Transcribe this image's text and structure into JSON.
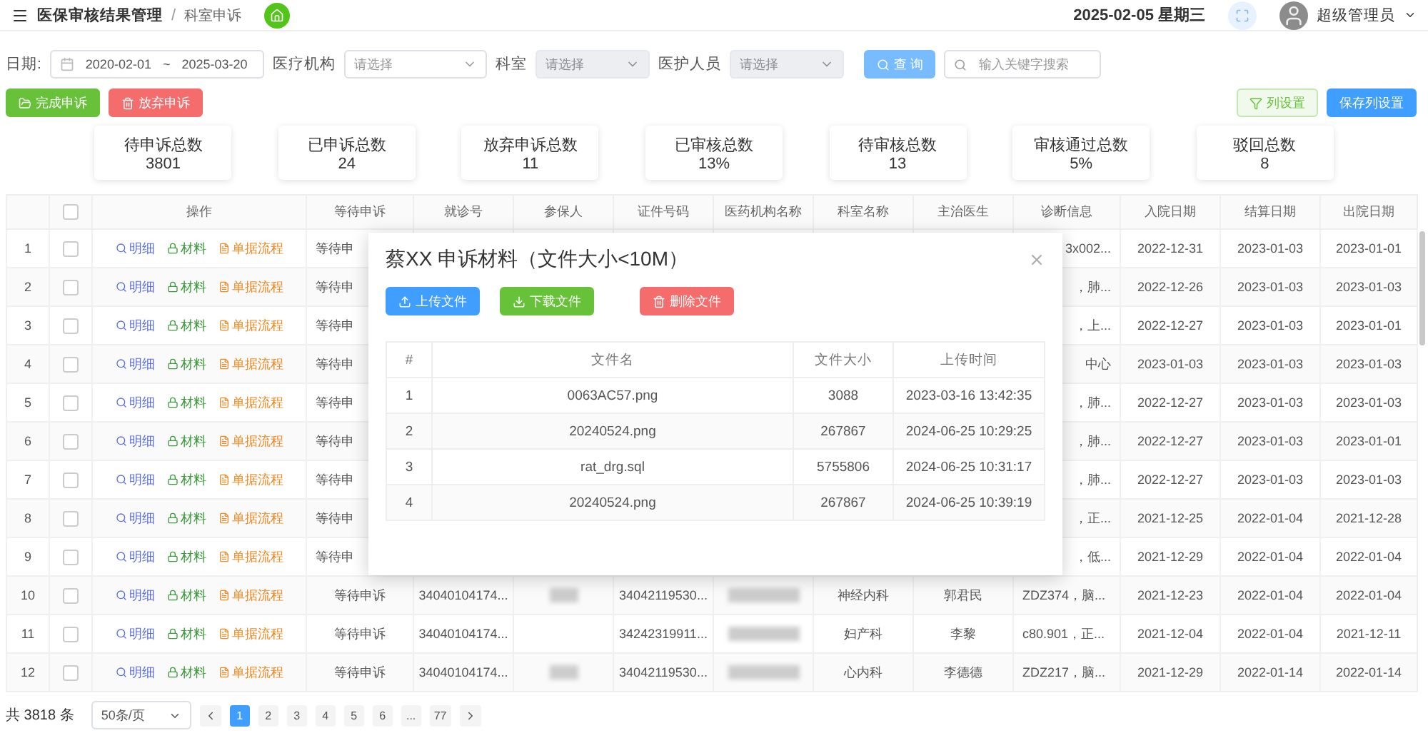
{
  "header": {
    "title": "医保审核结果管理",
    "separator": "/",
    "page": "科室申诉",
    "date": "2025-02-05 星期三",
    "user": "超级管理员"
  },
  "filters": [
    {
      "kind": "date",
      "label": "日期:",
      "start": "2020-02-01",
      "sep": "~",
      "end": "2025-03-20"
    },
    {
      "kind": "select",
      "label": "医疗机构",
      "placeholder": "请选择",
      "disabled": false
    },
    {
      "kind": "select",
      "label": "科室",
      "placeholder": "请选择",
      "disabled": true
    },
    {
      "kind": "select",
      "label": "医护人员",
      "placeholder": "请选择",
      "disabled": true
    },
    {
      "kind": "button",
      "label": "查 询"
    },
    {
      "kind": "search",
      "placeholder": "输入关键字搜索"
    }
  ],
  "actions": [
    {
      "label": "完成申诉",
      "kind": "complete"
    },
    {
      "label": "放弃申诉",
      "kind": "abandon"
    }
  ],
  "column_actions": [
    {
      "label": "列设置",
      "kind": "outline"
    },
    {
      "label": "保存列设置",
      "kind": "primary"
    }
  ],
  "stats": [
    {
      "label": "待申诉总数",
      "value": "3801"
    },
    {
      "label": "已申诉总数",
      "value": "24"
    },
    {
      "label": "放弃申诉总数",
      "value": "11"
    },
    {
      "label": "已审核总数",
      "value": "13%"
    },
    {
      "label": "待审核总数",
      "value": "13"
    },
    {
      "label": "审核通过总数",
      "value": "5%"
    },
    {
      "label": "驳回总数",
      "value": "8"
    }
  ],
  "table": {
    "columns": [
      "操作",
      "等待申诉",
      "就诊号",
      "参保人",
      "证件号码",
      "医药机构名称",
      "科室名称",
      "主治医生",
      "诊断信息",
      "入院日期",
      "结算日期",
      "出院日期"
    ],
    "select_all_checked": false,
    "rows": [
      {
        "kind": "partly_hidden",
        "index": "1",
        "checked": false,
        "actions": [
          {
            "label": "明细",
            "kind": "detail"
          },
          {
            "label": "材料",
            "kind": "material"
          },
          {
            "label": "单据流程",
            "kind": "flow"
          }
        ],
        "status": "等待申",
        "diagnosis": "3x002...",
        "admit": "2022-12-31",
        "settle": "2023-01-03",
        "discharge": "2023-01-01"
      },
      {
        "kind": "partly_hidden",
        "index": "2",
        "checked": false,
        "actions": [
          {
            "label": "明细",
            "kind": "detail"
          },
          {
            "label": "材料",
            "kind": "material"
          },
          {
            "label": "单据流程",
            "kind": "flow"
          }
        ],
        "status": "等待申",
        "diagnosis": "，肺...",
        "admit": "2022-12-26",
        "settle": "2023-01-03",
        "discharge": "2023-01-03"
      },
      {
        "kind": "partly_hidden",
        "index": "3",
        "checked": false,
        "actions": [
          {
            "label": "明细",
            "kind": "detail"
          },
          {
            "label": "材料",
            "kind": "material"
          },
          {
            "label": "单据流程",
            "kind": "flow"
          }
        ],
        "status": "等待申",
        "diagnosis": "，上...",
        "admit": "2022-12-27",
        "settle": "2023-01-03",
        "discharge": "2023-01-01"
      },
      {
        "kind": "partly_hidden",
        "index": "4",
        "checked": false,
        "actions": [
          {
            "label": "明细",
            "kind": "detail"
          },
          {
            "label": "材料",
            "kind": "material"
          },
          {
            "label": "单据流程",
            "kind": "flow"
          }
        ],
        "status": "等待申",
        "diagnosis": "中心",
        "admit": "2023-01-03",
        "settle": "2023-01-03",
        "discharge": "2023-01-03"
      },
      {
        "kind": "partly_hidden",
        "index": "5",
        "checked": false,
        "actions": [
          {
            "label": "明细",
            "kind": "detail"
          },
          {
            "label": "材料",
            "kind": "material"
          },
          {
            "label": "单据流程",
            "kind": "flow"
          }
        ],
        "status": "等待申",
        "diagnosis": "，肺...",
        "admit": "2022-12-27",
        "settle": "2023-01-03",
        "discharge": "2023-01-03"
      },
      {
        "kind": "partly_hidden",
        "index": "6",
        "checked": false,
        "actions": [
          {
            "label": "明细",
            "kind": "detail"
          },
          {
            "label": "材料",
            "kind": "material"
          },
          {
            "label": "单据流程",
            "kind": "flow"
          }
        ],
        "status": "等待申",
        "diagnosis": "，肺...",
        "admit": "2022-12-27",
        "settle": "2023-01-03",
        "discharge": "2023-01-01"
      },
      {
        "kind": "partly_hidden",
        "index": "7",
        "checked": false,
        "actions": [
          {
            "label": "明细",
            "kind": "detail"
          },
          {
            "label": "材料",
            "kind": "material"
          },
          {
            "label": "单据流程",
            "kind": "flow"
          }
        ],
        "status": "等待申",
        "diagnosis": "，肺...",
        "admit": "2022-12-27",
        "settle": "2023-01-03",
        "discharge": "2023-01-03"
      },
      {
        "kind": "partly_hidden",
        "index": "8",
        "checked": false,
        "actions": [
          {
            "label": "明细",
            "kind": "detail"
          },
          {
            "label": "材料",
            "kind": "material"
          },
          {
            "label": "单据流程",
            "kind": "flow"
          }
        ],
        "status": "等待申",
        "diagnosis": "，正...",
        "admit": "2021-12-25",
        "settle": "2022-01-04",
        "discharge": "2021-12-28"
      },
      {
        "kind": "partly_hidden",
        "index": "9",
        "checked": false,
        "actions": [
          {
            "label": "明细",
            "kind": "detail"
          },
          {
            "label": "材料",
            "kind": "material"
          },
          {
            "label": "单据流程",
            "kind": "flow"
          }
        ],
        "status": "等待申",
        "diagnosis": "，低...",
        "admit": "2021-12-29",
        "settle": "2022-01-04",
        "discharge": "2022-01-04"
      },
      {
        "kind": "full",
        "index": "10",
        "checked": false,
        "actions": [
          {
            "label": "明细",
            "kind": "detail"
          },
          {
            "label": "材料",
            "kind": "material"
          },
          {
            "label": "单据流程",
            "kind": "flow"
          }
        ],
        "status": "等待申诉",
        "visit_no": "34040104174...",
        "patient_redacted": true,
        "id_no": "34042119530...",
        "hospital_redacted": true,
        "dept": "神经内科",
        "doctor": "郭君民",
        "diagnosis": "ZDZ374，脑...",
        "admit": "2021-12-23",
        "settle": "2022-01-04",
        "discharge": "2022-01-04"
      },
      {
        "kind": "full",
        "index": "11",
        "checked": false,
        "actions": [
          {
            "label": "明细",
            "kind": "detail"
          },
          {
            "label": "材料",
            "kind": "material"
          },
          {
            "label": "单据流程",
            "kind": "flow"
          }
        ],
        "status": "等待申诉",
        "visit_no": "34040104174...",
        "patient_redacted": false,
        "id_no": "34242319911...",
        "hospital_redacted": true,
        "dept": "妇产科",
        "doctor": "李黎",
        "diagnosis": "c80.901，正...",
        "admit": "2021-12-04",
        "settle": "2022-01-04",
        "discharge": "2021-12-11"
      },
      {
        "kind": "full",
        "index": "12",
        "checked": false,
        "actions": [
          {
            "label": "明细",
            "kind": "detail"
          },
          {
            "label": "材料",
            "kind": "material"
          },
          {
            "label": "单据流程",
            "kind": "flow"
          }
        ],
        "status": "等待申诉",
        "visit_no": "34040104174...",
        "patient_redacted": true,
        "id_no": "34042119530...",
        "hospital_redacted": true,
        "dept": "心内科",
        "doctor": "李德德",
        "diagnosis": "ZDZ217，脑...",
        "admit": "2021-12-29",
        "settle": "2022-01-14",
        "discharge": "2022-01-14"
      }
    ]
  },
  "pagination": {
    "total": "共 3818 条",
    "page_size": "50条/页",
    "pages": [
      {
        "label": "1",
        "selected": true
      },
      {
        "label": "2",
        "selected": false
      },
      {
        "label": "3",
        "selected": false
      },
      {
        "label": "4",
        "selected": false
      },
      {
        "label": "5",
        "selected": false
      },
      {
        "label": "6",
        "selected": false
      },
      {
        "label": "...",
        "selected": false
      },
      {
        "label": "77",
        "selected": false
      }
    ]
  },
  "dialog": {
    "title": "蔡XX 申诉材料（文件大小<10M）",
    "buttons": [
      {
        "label": "上传文件",
        "kind": "upload"
      },
      {
        "label": "下载文件",
        "kind": "download"
      },
      {
        "label": "删除文件",
        "kind": "delete"
      }
    ],
    "columns": [
      "#",
      "文件名",
      "文件大小",
      "上传时间"
    ],
    "files": [
      {
        "index": "1",
        "name": "0063AC57.png",
        "size": "3088",
        "time": "2023-03-16 13:42:35"
      },
      {
        "index": "2",
        "name": "20240524.png",
        "size": "267867",
        "time": "2024-06-25 10:29:25"
      },
      {
        "index": "3",
        "name": "rat_drg.sql",
        "size": "5755806",
        "time": "2024-06-25 10:31:17"
      },
      {
        "index": "4",
        "name": "20240524.png",
        "size": "267867",
        "time": "2024-06-25 10:39:19"
      }
    ]
  }
}
